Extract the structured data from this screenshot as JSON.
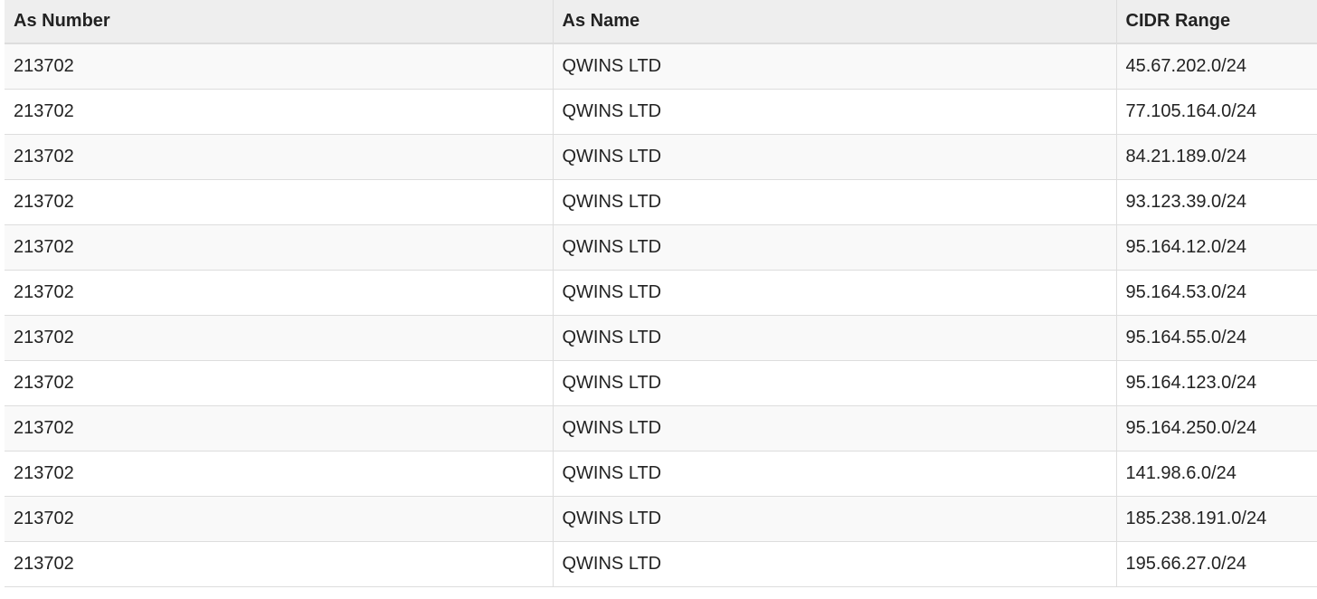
{
  "table": {
    "columns": [
      "As Number",
      "As Name",
      "CIDR Range"
    ],
    "rows": [
      {
        "as_number": "213702",
        "as_name": "QWINS LTD",
        "cidr": "45.67.202.0/24"
      },
      {
        "as_number": "213702",
        "as_name": "QWINS LTD",
        "cidr": "77.105.164.0/24"
      },
      {
        "as_number": "213702",
        "as_name": "QWINS LTD",
        "cidr": "84.21.189.0/24"
      },
      {
        "as_number": "213702",
        "as_name": "QWINS LTD",
        "cidr": "93.123.39.0/24"
      },
      {
        "as_number": "213702",
        "as_name": "QWINS LTD",
        "cidr": "95.164.12.0/24"
      },
      {
        "as_number": "213702",
        "as_name": "QWINS LTD",
        "cidr": "95.164.53.0/24"
      },
      {
        "as_number": "213702",
        "as_name": "QWINS LTD",
        "cidr": "95.164.55.0/24"
      },
      {
        "as_number": "213702",
        "as_name": "QWINS LTD",
        "cidr": "95.164.123.0/24"
      },
      {
        "as_number": "213702",
        "as_name": "QWINS LTD",
        "cidr": "95.164.250.0/24"
      },
      {
        "as_number": "213702",
        "as_name": "QWINS LTD",
        "cidr": "141.98.6.0/24"
      },
      {
        "as_number": "213702",
        "as_name": "QWINS LTD",
        "cidr": "185.238.191.0/24"
      },
      {
        "as_number": "213702",
        "as_name": "QWINS LTD",
        "cidr": "195.66.27.0/24"
      }
    ]
  }
}
